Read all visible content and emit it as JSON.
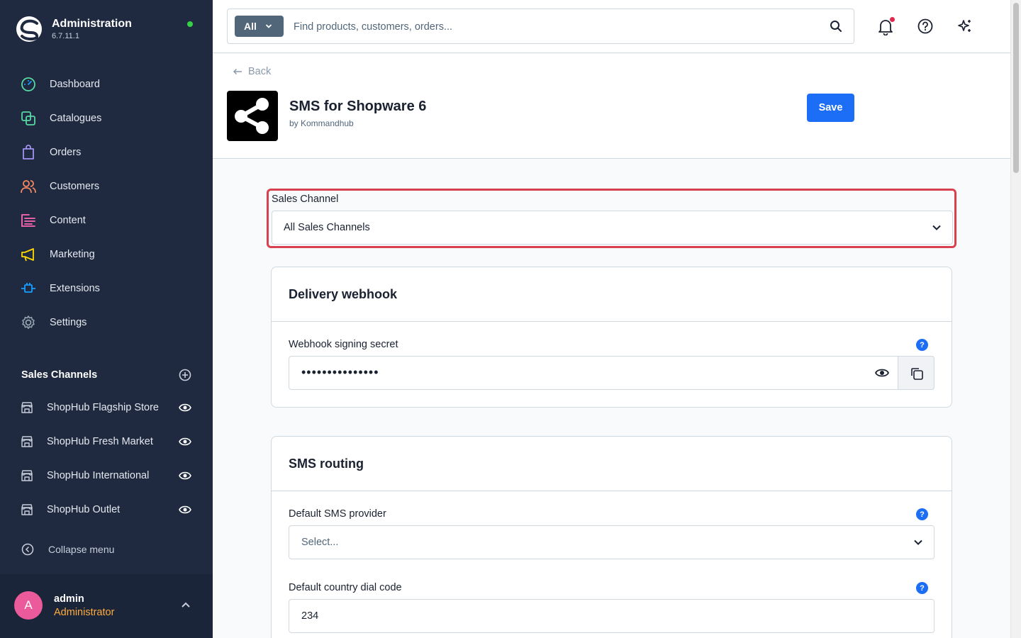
{
  "app": {
    "title": "Administration",
    "version": "6.7.11.1",
    "status_color": "#37d046"
  },
  "sidebar": {
    "items": [
      {
        "label": "Dashboard",
        "icon": "dashboard-icon",
        "color": "#57d9a3"
      },
      {
        "label": "Catalogues",
        "icon": "catalogue-icon",
        "color": "#57d9a3"
      },
      {
        "label": "Orders",
        "icon": "orders-icon",
        "color": "#a092f0"
      },
      {
        "label": "Customers",
        "icon": "customers-icon",
        "color": "#f88962"
      },
      {
        "label": "Content",
        "icon": "content-icon",
        "color": "#ff68b4"
      },
      {
        "label": "Marketing",
        "icon": "megaphone-icon",
        "color": "#ffd700"
      },
      {
        "label": "Extensions",
        "icon": "plug-icon",
        "color": "#189eff"
      },
      {
        "label": "Settings",
        "icon": "gear-icon",
        "color": "#9aa8b5"
      }
    ],
    "sales_channels_title": "Sales Channels",
    "sales_channels": [
      {
        "label": "ShopHub Flagship Store"
      },
      {
        "label": "ShopHub Fresh Market"
      },
      {
        "label": "ShopHub International"
      },
      {
        "label": "ShopHub Outlet"
      }
    ],
    "collapse_label": "Collapse menu",
    "user": {
      "initial": "A",
      "name": "admin",
      "role": "Administrator"
    }
  },
  "topbar": {
    "search_type": "All",
    "search_placeholder": "Find products, customers, orders..."
  },
  "page": {
    "back_label": "Back",
    "plugin_title": "SMS for Shopware 6",
    "plugin_by": "by Kommandhub",
    "save_label": "Save",
    "sales_channel_label": "Sales Channel",
    "sales_channel_value": "All Sales Channels"
  },
  "cards": {
    "webhook": {
      "title": "Delivery webhook",
      "secret_label": "Webhook signing secret",
      "secret_value": "•••••••••••••••"
    },
    "routing": {
      "title": "SMS routing",
      "provider_label": "Default SMS provider",
      "provider_placeholder": "Select...",
      "dial_code_label": "Default country dial code",
      "dial_code_value": "234"
    }
  },
  "colors": {
    "accent": "#1c6ef7",
    "sidebar_bg": "#1f2a40",
    "highlight": "#d94150"
  }
}
